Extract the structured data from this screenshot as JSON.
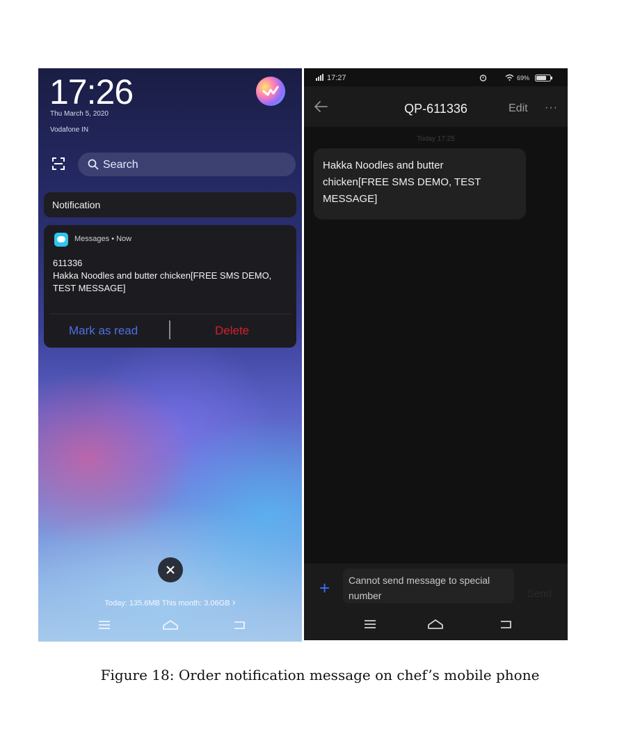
{
  "left_screen": {
    "time": "17:26",
    "date": "Thu March 5, 2020",
    "carrier": "Vodafone IN",
    "search": {
      "placeholder": "Search"
    },
    "notification_header": "Notification",
    "notification": {
      "app": "Messages • Now",
      "sender": "611336",
      "body": "Hakka Noodles and butter chicken[FREE SMS DEMO, TEST MESSAGE]",
      "mark_as_read": "Mark as read",
      "delete": "Delete"
    },
    "data_usage": "Today: 135.6MB This month: 3.06GB",
    "data_usage_arrow": "›"
  },
  "right_screen": {
    "status": {
      "time": "17:27",
      "battery": "69%"
    },
    "title": "QP-611336",
    "edit": "Edit",
    "more": "···",
    "timestamp": "Today 17:25",
    "message": "Hakka Noodles and butter chicken[FREE SMS DEMO, TEST MESSAGE]",
    "plus": "+",
    "input_placeholder": "Cannot send message to special number",
    "send": "Send"
  },
  "caption": "Figure 18: Order notification message on chef’s mobile phone",
  "colors": {
    "accent_blue": "#4f6fe3",
    "delete_red": "#d3202a",
    "messages_app": "#2ec5f0"
  },
  "icons": [
    "scan-icon",
    "search-icon",
    "messages-app-icon",
    "close-icon",
    "back-arrow-icon",
    "menu-icon",
    "home-icon",
    "return-icon",
    "alarm-icon",
    "wifi-icon",
    "battery-icon",
    "signal-icon"
  ]
}
